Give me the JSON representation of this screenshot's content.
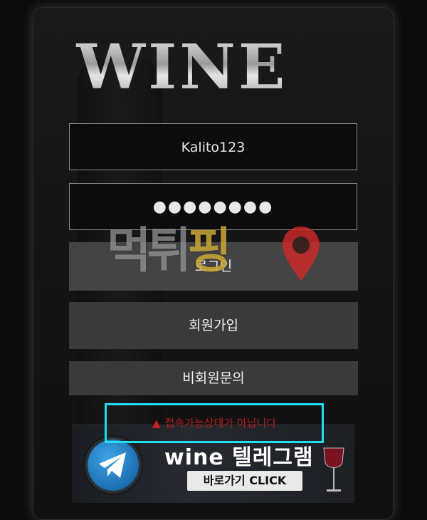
{
  "logo": {
    "text": "WINE"
  },
  "form": {
    "username_value": "Kalito123",
    "password_value": "●●●●●●●●",
    "login_label": "로그인",
    "signup_label": "회원가입",
    "guest_inquiry_label": "비회원문의"
  },
  "watermark": {
    "text_part1": "먹튀",
    "text_part2": "핑"
  },
  "notice": {
    "icon": "warning-icon",
    "text": "접속가능상태가 아닙니다"
  },
  "banner": {
    "title": "wine 텔레그램",
    "cta_label": "바로가기 CLICK",
    "icon": "telegram-icon"
  },
  "colors": {
    "highlight_border": "#1ee0f0",
    "notice_text": "#b11f1f",
    "button_bg": "#3a3a3a"
  }
}
